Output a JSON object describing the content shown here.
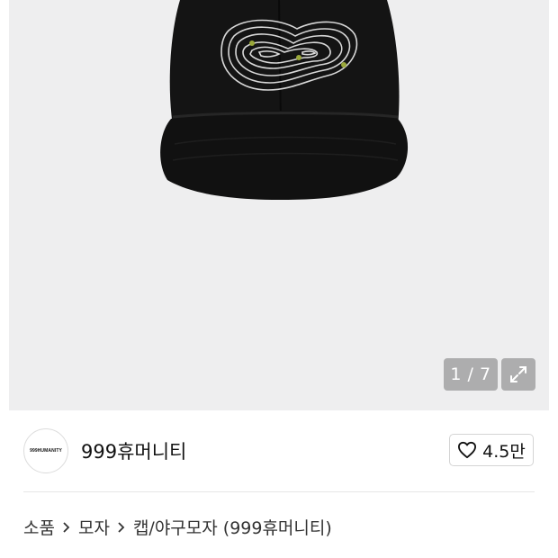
{
  "gallery": {
    "image_alt": "black cap with embroidered contour pattern",
    "counter_text": "1 / 7",
    "expand_icon": "expand-arrows-icon"
  },
  "brand": {
    "logo_text": "999HUMANITY",
    "name": "999휴머니티",
    "like_icon": "heart-outline-icon",
    "like_count": "4.5만"
  },
  "breadcrumb": {
    "items": [
      "소품",
      "모자",
      "캡/야구모자 (999휴머니티)"
    ],
    "separator_icon": "chevron-right-icon"
  },
  "colors": {
    "gallery_bg": "#eeeeef",
    "cap": "#111111",
    "embroidery": "#d8d8d8",
    "accent_dots": "#9aa83a"
  }
}
